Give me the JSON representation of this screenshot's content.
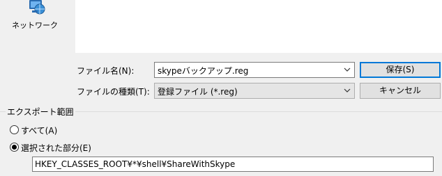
{
  "sidebar": {
    "network_label": "ネットワーク",
    "network_icon": "network-icon"
  },
  "form": {
    "filename_label": "ファイル名(N):",
    "filename_value": "skypeバックアップ.reg",
    "filetype_label": "ファイルの種類(T):",
    "filetype_value": "登録ファイル (*.reg)"
  },
  "buttons": {
    "save": "保存(S)",
    "cancel": "キャンセル"
  },
  "export": {
    "title": "エクスポート範囲",
    "all_label": "すべて(A)",
    "selected_label": "選択された部分(E)",
    "selected_checked": true,
    "branch_value": "HKEY_CLASSES_ROOT¥*¥shell¥ShareWithSkype"
  },
  "colors": {
    "accent": "#0078d7",
    "window_bg": "#f0f0f0"
  }
}
